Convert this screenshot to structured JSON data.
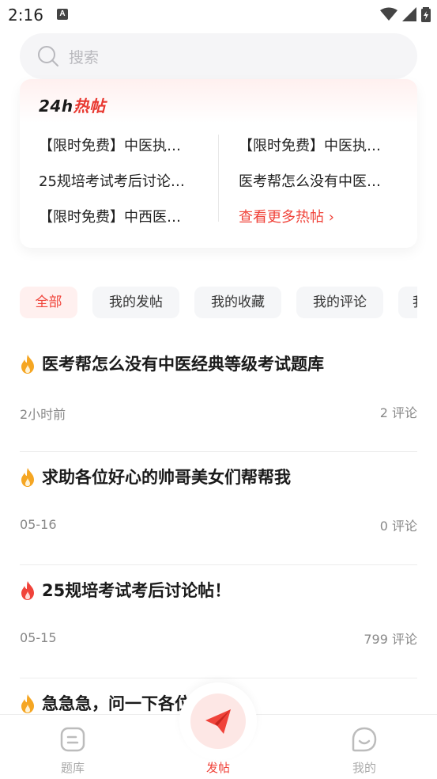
{
  "status_bar": {
    "time": "2:16",
    "badge": "A"
  },
  "search": {
    "placeholder": "搜索"
  },
  "hot": {
    "title_prefix": "24h",
    "title_suffix": "热帖",
    "left_items": [
      "【限时免费】中医执…",
      "25规培考试考后讨论…",
      "【限时免费】中西医…"
    ],
    "right_items": [
      "【限时免费】中医执…",
      "医考帮怎么没有中医…"
    ],
    "more_label": "查看更多热帖 ›"
  },
  "tabs": [
    {
      "label": "全部",
      "active": true
    },
    {
      "label": "我的发帖",
      "active": false
    },
    {
      "label": "我的收藏",
      "active": false
    },
    {
      "label": "我的评论",
      "active": false
    },
    {
      "label": "我",
      "active": false
    }
  ],
  "posts": [
    {
      "title": "医考帮怎么没有中医经典等级考试题库",
      "time": "2小时前",
      "comments": "2 评论",
      "fire_color": "#f5a623"
    },
    {
      "title": "求助各位好心的帅哥美女们帮帮我",
      "time": "05-16",
      "comments": "0 评论",
      "fire_color": "#f5a623"
    },
    {
      "title": "25规培考试考后讨论帖！",
      "time": "05-15",
      "comments": "799 评论",
      "fire_color": "#f0433a"
    },
    {
      "title": "急急急，问一下各位",
      "time": "",
      "comments": "",
      "fire_color": "#f5a623"
    }
  ],
  "bottom_nav": [
    {
      "label": "题库",
      "icon": "question-bank-icon",
      "active": false
    },
    {
      "label": "发帖",
      "icon": "paper-plane-icon",
      "active": true
    },
    {
      "label": "我的",
      "icon": "profile-face-icon",
      "active": false
    }
  ],
  "colors": {
    "accent": "#f0433a",
    "fire_orange": "#f5a623",
    "muted": "#888888"
  }
}
